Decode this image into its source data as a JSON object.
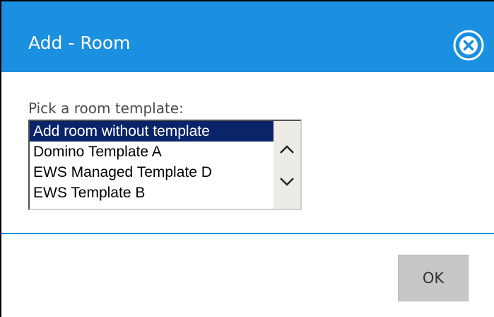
{
  "dialog": {
    "title": "Add - Room",
    "close_icon": "close-circle-icon",
    "accent_color": "#1b8fe0"
  },
  "form": {
    "prompt": "Pick a room template:",
    "templates": [
      "Add room without template",
      "Domino Template A",
      "EWS Managed Template D",
      "EWS Template B"
    ],
    "selected_index": 0,
    "selection_color": "#0a246a",
    "scroll_up_icon": "chevron-up-icon",
    "scroll_down_icon": "chevron-down-icon"
  },
  "footer": {
    "ok_label": "OK"
  }
}
